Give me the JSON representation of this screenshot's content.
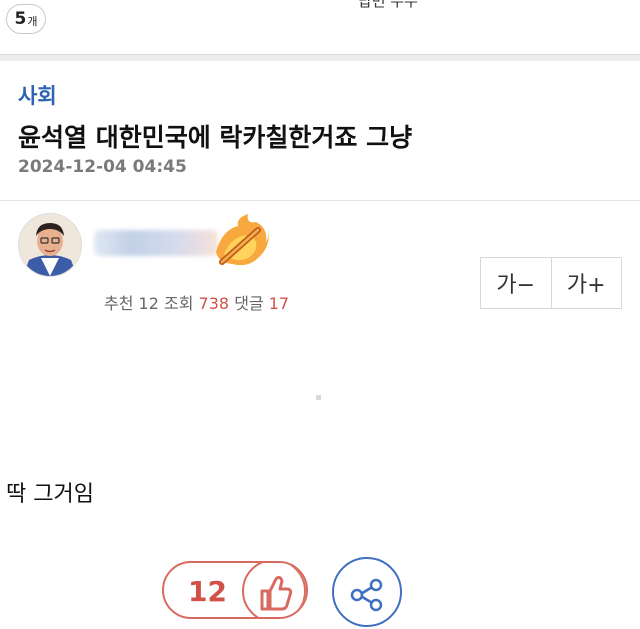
{
  "top": {
    "comment_count": "5",
    "comment_unit": "개",
    "cut_text": "답변 수수"
  },
  "post": {
    "category": "사회",
    "title": "윤석열 대한민국에 락카칠한거죠 그냥",
    "date": "2024-12-04 04:45",
    "stats": {
      "recommend_label": "추천",
      "recommend_value": "12",
      "views_label": "조회",
      "views_value": "738",
      "comments_label": "댓글",
      "comments_value": "17"
    },
    "body": "딱 그거임"
  },
  "font_controls": {
    "decrease": "가−",
    "increase": "가+"
  },
  "actions": {
    "like_count": "12"
  },
  "colors": {
    "category": "#2c64b2",
    "like_accent": "#d96a60",
    "share_accent": "#3f6fc0"
  }
}
